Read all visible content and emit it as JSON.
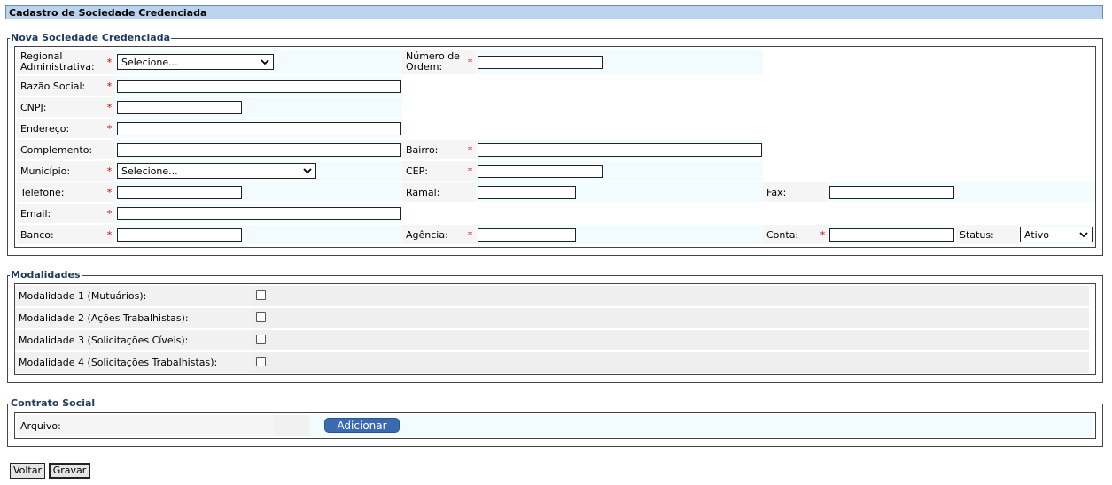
{
  "page_title": "Cadastro de Sociedade Credenciada",
  "sections": {
    "nova": "Nova Sociedade Credenciada",
    "modalidades": "Modalidades",
    "contrato": "Contrato Social"
  },
  "required_mark": "*",
  "form": {
    "regional_label": "Regional Administrativa:",
    "regional_value": "Selecione...",
    "numero_label": "Número de Ordem:",
    "razao_label": "Razão Social:",
    "cnpj_label": "CNPJ:",
    "endereco_label": "Endereço:",
    "complemento_label": "Complemento:",
    "bairro_label": "Bairro:",
    "municipio_label": "Município:",
    "municipio_value": "Selecione...",
    "cep_label": "CEP:",
    "telefone_label": "Telefone:",
    "ramal_label": "Ramal:",
    "fax_label": "Fax:",
    "email_label": "Email:",
    "banco_label": "Banco:",
    "agencia_label": "Agência:",
    "conta_label": "Conta:",
    "status_label": "Status:",
    "status_value": "Ativo"
  },
  "modalidades": [
    {
      "label": "Modalidade 1 (Mutuários):",
      "checked": false
    },
    {
      "label": "Modalidade 2 (Ações Trabalhistas):",
      "checked": false
    },
    {
      "label": "Modalidade 3 (Solicitações Cíveis):",
      "checked": false
    },
    {
      "label": "Modalidade 4 (Solicitações Trabalhistas):",
      "checked": false
    }
  ],
  "contrato": {
    "arquivo_label": "Arquivo:",
    "add_button": "Adicionar"
  },
  "buttons": {
    "voltar": "Voltar",
    "gravar": "Gravar"
  }
}
